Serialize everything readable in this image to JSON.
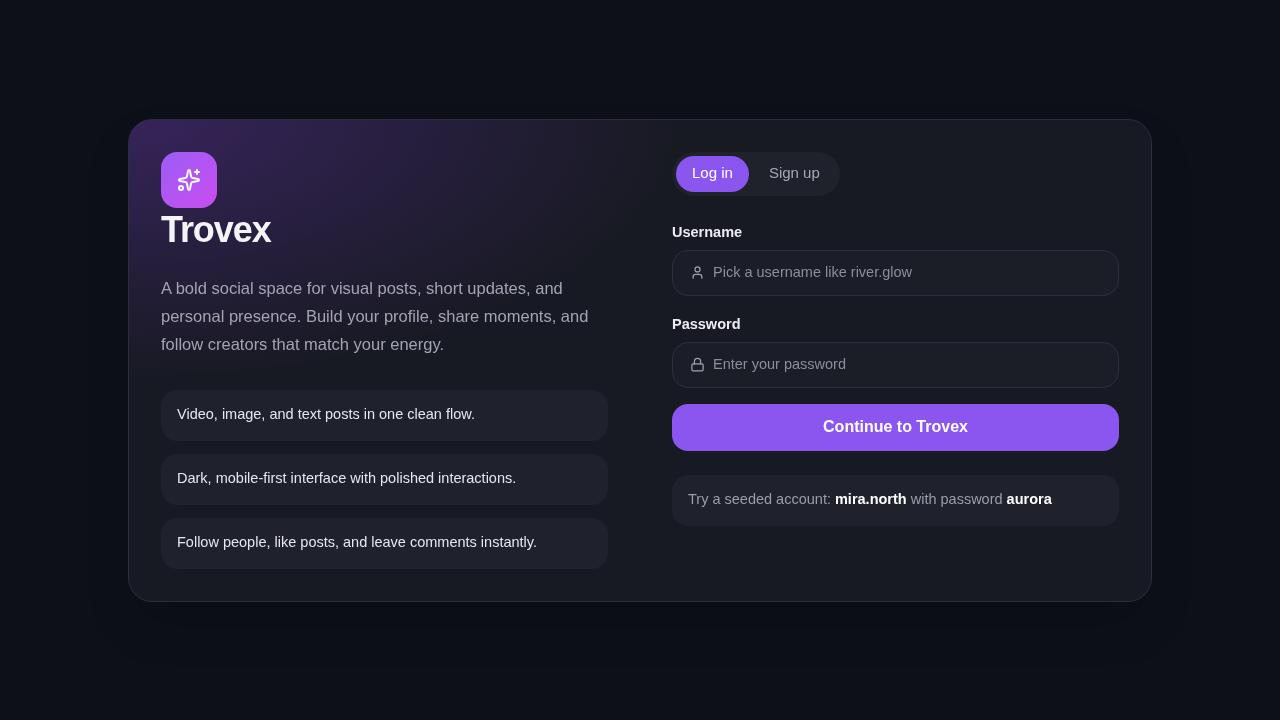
{
  "brand": {
    "name": "Trovex",
    "tagline": "A bold social space for visual posts, short updates, and personal presence. Build your profile, share moments, and follow creators that match your energy."
  },
  "features": [
    "Video, image, and text posts in one clean flow.",
    "Dark, mobile-first interface with polished interactions.",
    "Follow people, like posts, and leave comments instantly."
  ],
  "auth_tabs": [
    {
      "label": "Log in",
      "selected": true
    },
    {
      "label": "Sign up",
      "selected": false
    }
  ],
  "fields": [
    {
      "kind": "username",
      "label": "Username",
      "placeholder": "Pick a username like river.glow"
    },
    {
      "kind": "password",
      "label": "Password",
      "placeholder": "Enter your password"
    }
  ],
  "submit_button": "Continue to Trovex",
  "hint": "Try a seeded account: **mira.north** with password **aurora**"
}
